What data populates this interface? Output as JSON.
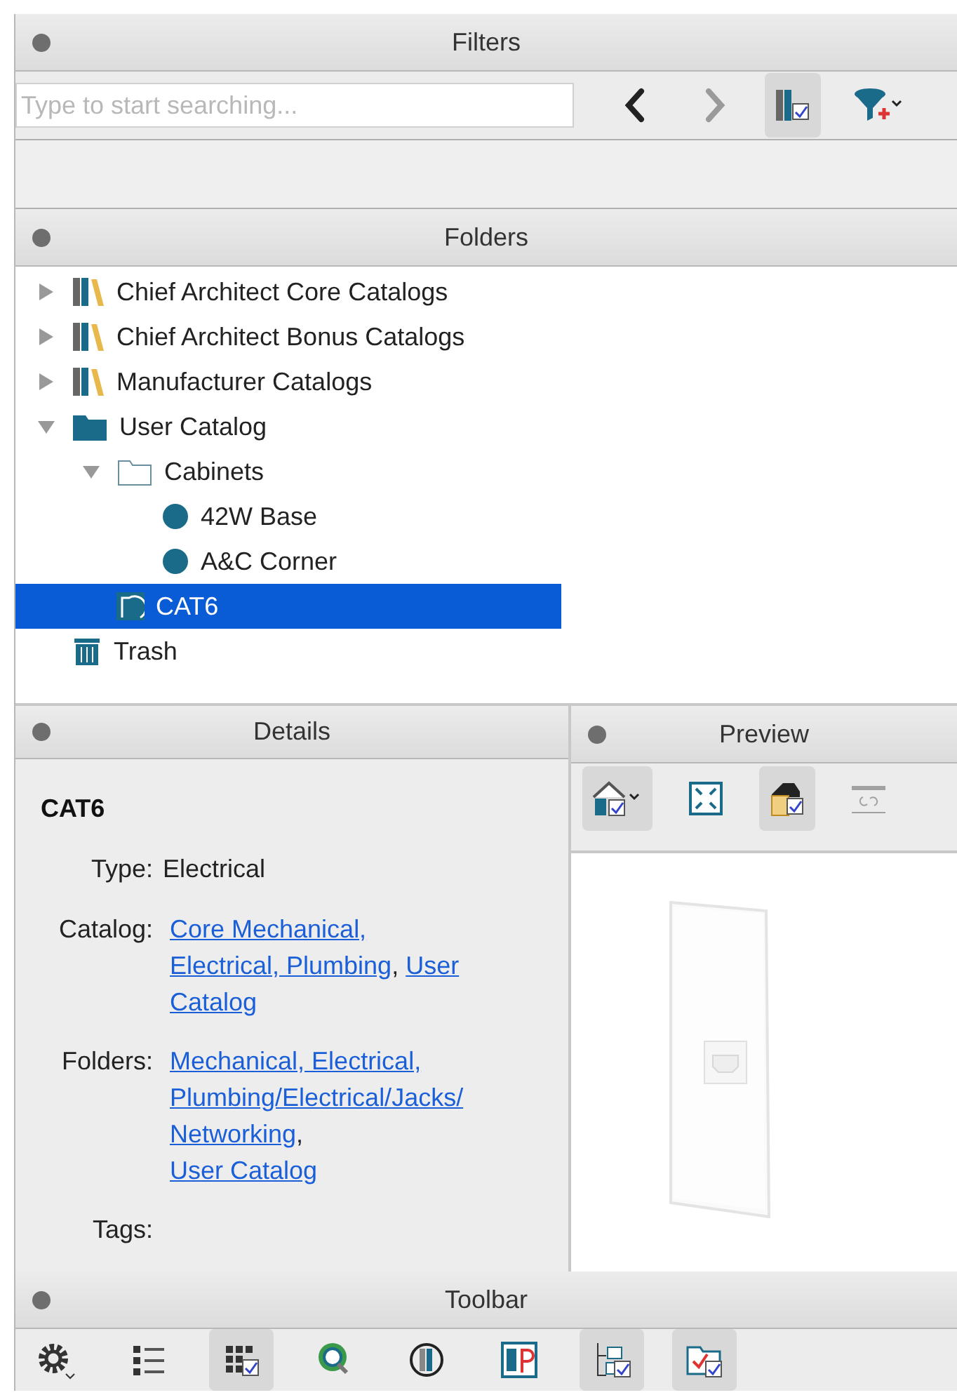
{
  "filters": {
    "title": "Filters",
    "search": {
      "placeholder": "Type to start searching..."
    },
    "tools": [
      {
        "kind": "back",
        "disabled": false,
        "selected": false
      },
      {
        "kind": "forward",
        "disabled": true,
        "selected": false
      },
      {
        "kind": "catalog",
        "disabled": false,
        "selected": true
      },
      {
        "kind": "filter",
        "disabled": false,
        "selected": false
      }
    ]
  },
  "folders": {
    "title": "Folders",
    "items": [
      {
        "label": "Chief Architect Core Catalogs",
        "kind": "library",
        "expanded": false,
        "selected": false
      },
      {
        "label": "Chief Architect Bonus Catalogs",
        "kind": "library",
        "expanded": false,
        "selected": false
      },
      {
        "label": "Manufacturer Catalogs",
        "kind": "library",
        "expanded": false,
        "selected": false
      },
      {
        "label": "User Catalog",
        "kind": "folder",
        "expanded": true,
        "selected": false,
        "children": [
          {
            "label": "Cabinets",
            "kind": "open-folder",
            "expanded": true,
            "selected": false,
            "children": [
              {
                "label": "42W Base",
                "kind": "dot",
                "selected": false
              },
              {
                "label": "A&C Corner",
                "kind": "dot",
                "selected": false
              }
            ]
          },
          {
            "label": "CAT6",
            "kind": "arc",
            "selected": true
          }
        ]
      },
      {
        "label": "Trash",
        "kind": "trash",
        "selected": false
      }
    ]
  },
  "details": {
    "title": "Details",
    "name": "CAT6",
    "fields": [
      {
        "label": "Type:",
        "lines": [
          [
            {
              "text": "Electrical",
              "link": false
            }
          ]
        ]
      },
      {
        "label": "Catalog:",
        "lines": [
          [
            {
              "text": "Core Mechanical,",
              "link": true
            }
          ],
          [
            {
              "text": "Electrical, Plumbing",
              "link": true
            },
            {
              "text": ",",
              "link": false
            },
            {
              "text": "User",
              "link": true
            }
          ],
          [
            {
              "text": "Catalog",
              "link": true
            }
          ]
        ]
      },
      {
        "label": "Folders:",
        "lines": [
          [
            {
              "text": "Mechanical, Electrical,",
              "link": true
            }
          ],
          [
            {
              "text": "Plumbing/Electrical/Jacks/",
              "link": true
            }
          ],
          [
            {
              "text": "Networking",
              "link": true
            },
            {
              "text": ",",
              "link": false
            }
          ],
          [
            {
              "text": "User Catalog",
              "link": true
            }
          ]
        ]
      },
      {
        "label": "Tags:"
      }
    ]
  },
  "preview": {
    "title": "Preview",
    "tools": [
      {
        "kind": "house",
        "selected": true,
        "disabled": false
      },
      {
        "kind": "fit",
        "selected": false,
        "disabled": false
      },
      {
        "kind": "color-house",
        "selected": true,
        "disabled": false
      },
      {
        "kind": "refresh",
        "selected": false,
        "disabled": true
      }
    ]
  },
  "toolbar": {
    "title": "Toolbar",
    "tools": [
      {
        "kind": "gear",
        "selected": false
      },
      {
        "kind": "list",
        "selected": false
      },
      {
        "kind": "grid",
        "selected": true
      },
      {
        "kind": "search-tree",
        "selected": false
      },
      {
        "kind": "sync",
        "selected": false
      },
      {
        "kind": "p-panel",
        "selected": false
      },
      {
        "kind": "tree",
        "selected": true
      },
      {
        "kind": "folder-check",
        "selected": true
      }
    ]
  }
}
